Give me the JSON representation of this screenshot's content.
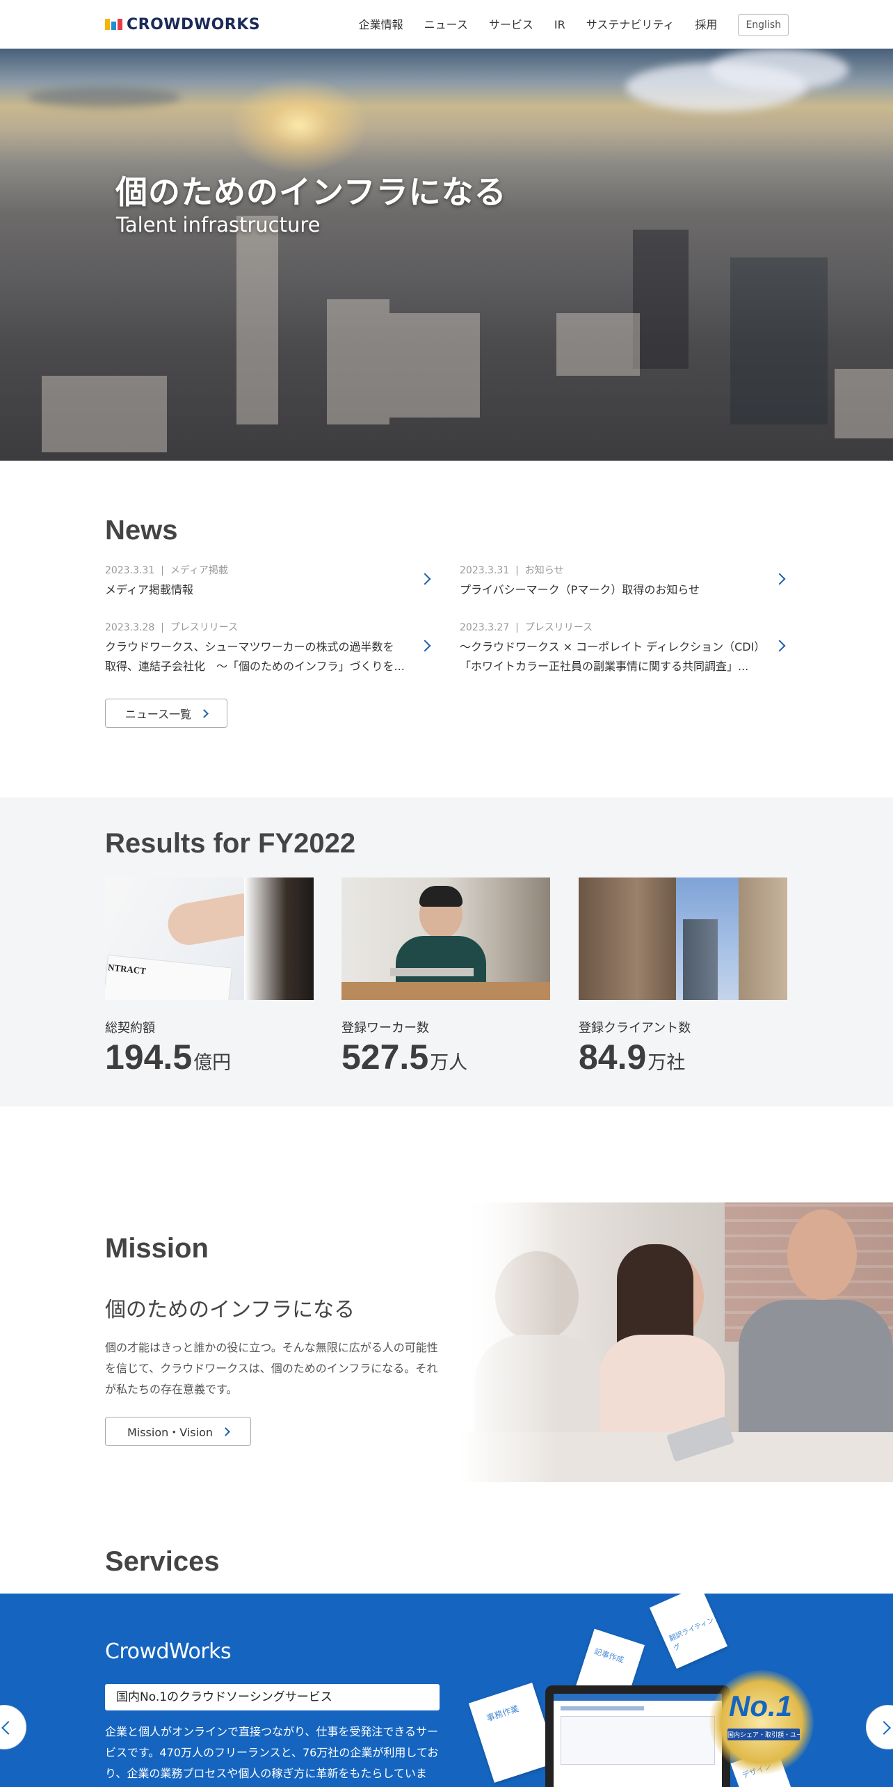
{
  "header": {
    "brand": "CROWDWORKS",
    "nav": [
      "企業情報",
      "ニュース",
      "サービス",
      "IR",
      "サステナビリティ",
      "採用"
    ],
    "lang_button": "English"
  },
  "hero": {
    "title": "個のためのインフラになる",
    "subtitle": "Talent infrastructure"
  },
  "news": {
    "title": "News",
    "items": [
      {
        "date": "2023.3.31",
        "category": "メディア掲載",
        "line1": "メディア掲載情報",
        "line2": ""
      },
      {
        "date": "2023.3.31",
        "category": "お知らせ",
        "line1": "プライバシーマーク（Pマーク）取得のお知らせ",
        "line2": ""
      },
      {
        "date": "2023.3.28",
        "category": "プレスリリース",
        "line1": "クラウドワークス、シューマツワーカーの株式の過半数を",
        "line2": "取得、連結子会社化　～「個のためのインフラ」づくりを..."
      },
      {
        "date": "2023.3.27",
        "category": "プレスリリース",
        "line1": "～クラウドワークス × コーポレイト ディレクション（CDI）",
        "line2": "「ホワイトカラー正社員の副業事情に関する共同調査」..."
      }
    ],
    "separator": "|",
    "more_button": "ニュース一覧"
  },
  "results": {
    "title": "Results for FY2022",
    "cards": [
      {
        "label": "総契約額",
        "value": "194.5",
        "unit": "億円",
        "image_text": "NTRACT"
      },
      {
        "label": "登録ワーカー数",
        "value": "527.5",
        "unit": "万人"
      },
      {
        "label": "登録クライアント数",
        "value": "84.9",
        "unit": "万社"
      }
    ]
  },
  "mission": {
    "title": "Mission",
    "subtitle": "個のためのインフラになる",
    "body": "個の才能はきっと誰かの役に立つ。そんな無限に広がる人の可能性を信じて、クラウドワークスは、個のためのインフラになる。それが私たちの存在意義です。",
    "button": "Mission・Vision"
  },
  "services": {
    "title": "Services",
    "brand": "CrowdWorks",
    "badge": "国内No.1のクラウドソーシングサービス",
    "body": "企業と個人がオンラインで直接つながり、仕事を受発注できるサービスです。470万人のフリーランスと、76万社の企業が利用しており、企業の業務プロセスや個人の稼ぎ方に革新をもたらしています。",
    "no1_label": "No.1",
    "no1_caption": "国内シェア・取引額・ユーザー数",
    "card_labels": [
      "事務作業",
      "記事作成",
      "翻訳ライティング",
      "デザイン"
    ]
  },
  "colors": {
    "accent": "#1565c0",
    "link": "#1a5fa8",
    "logo_navy": "#1b2a59",
    "results_bg": "#f4f5f7"
  }
}
